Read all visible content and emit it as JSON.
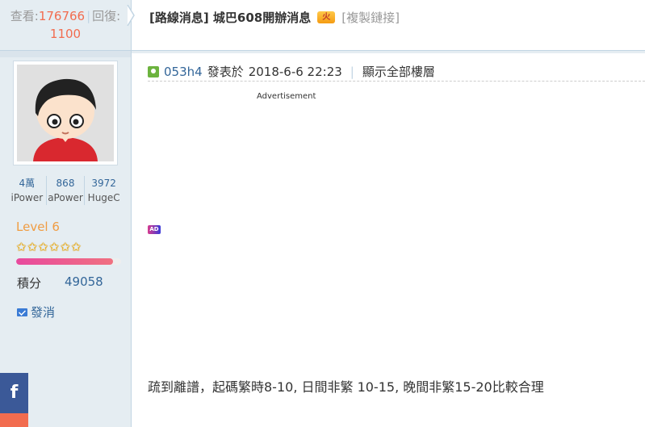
{
  "thread": {
    "views_label": "查看:",
    "views": "176766",
    "replies_label": "回復:",
    "replies": "1100",
    "title": "[路線消息] 城巴608開辦消息",
    "hot_icon_text": "火",
    "copy_link": "[複製鏈接]"
  },
  "user": {
    "counts": [
      {
        "value": "4萬",
        "label": "iPower"
      },
      {
        "value": "868",
        "label": "aPower"
      },
      {
        "value": "3972",
        "label": "HugeC"
      }
    ],
    "level": "Level 6",
    "star_count": 6,
    "level_progress": 0.92,
    "points_label": "積分",
    "points": "49058",
    "message_label": "發消"
  },
  "post": {
    "author": "053h4",
    "posted_label": "發表於",
    "datetime": "2018-6-6 22:23",
    "show_all_label": "顯示全部樓層",
    "ad_label": "Advertisement",
    "ad_badge": "AD",
    "body": "疏到離譜，起碼繁時8-10, 日間非繁 10-15, 晚間非繁15-20比較合理"
  },
  "share": {
    "facebook_glyph": "f"
  },
  "colors": {
    "sidebar_bg": "#e5edf2",
    "link_blue": "#336699",
    "accent_red": "#f26c4f",
    "level_orange": "#f09c42",
    "facebook_blue": "#3b5998"
  }
}
